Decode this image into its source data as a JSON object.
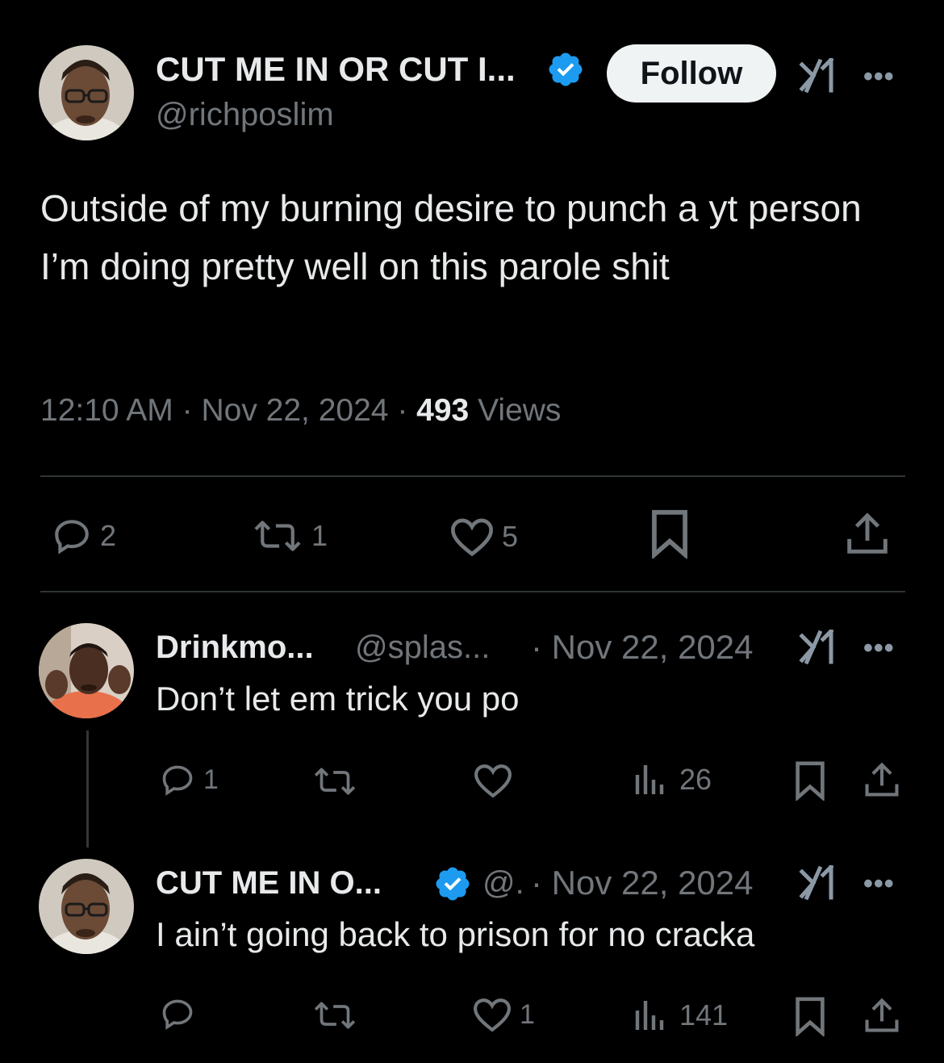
{
  "main_tweet": {
    "display_name": "CUT ME IN OR CUT I...",
    "handle": "@richposlim",
    "follow_label": "Follow",
    "text": "Outside of my burning desire to punch a yt person I’m doing pretty well on this parole shit",
    "time": "12:10 AM",
    "date": "Nov 22, 2024",
    "views_count": "493",
    "views_label": "Views",
    "separator": "·",
    "actions": {
      "replies": "2",
      "reposts": "1",
      "likes": "5"
    }
  },
  "replies": [
    {
      "display_name": "Drinkmo...",
      "handle": "@splas...",
      "date": "· Nov 22, 2024",
      "text": "Don’t let em trick you po",
      "actions": {
        "replies": "1",
        "reposts": "",
        "likes": "",
        "views": "26"
      }
    },
    {
      "display_name": "CUT ME IN O...",
      "handle": "@.",
      "date": "· Nov 22, 2024",
      "text": "I ain’t going back to prison for no cracka",
      "actions": {
        "replies": "",
        "reposts": "",
        "likes": "1",
        "views": "141"
      }
    }
  ],
  "more_glyph": "•••",
  "colors": {
    "background": "#000000",
    "text_primary": "#e7e9ea",
    "text_muted": "#71767b",
    "verified_blue": "#1d9bf0",
    "divider": "#2f3336",
    "follow_bg": "#eff3f4"
  },
  "icons": [
    "verified-badge-icon",
    "grok-icon",
    "more-icon",
    "reply-icon",
    "repost-icon",
    "like-icon",
    "bookmark-icon",
    "share-icon",
    "views-icon"
  ]
}
